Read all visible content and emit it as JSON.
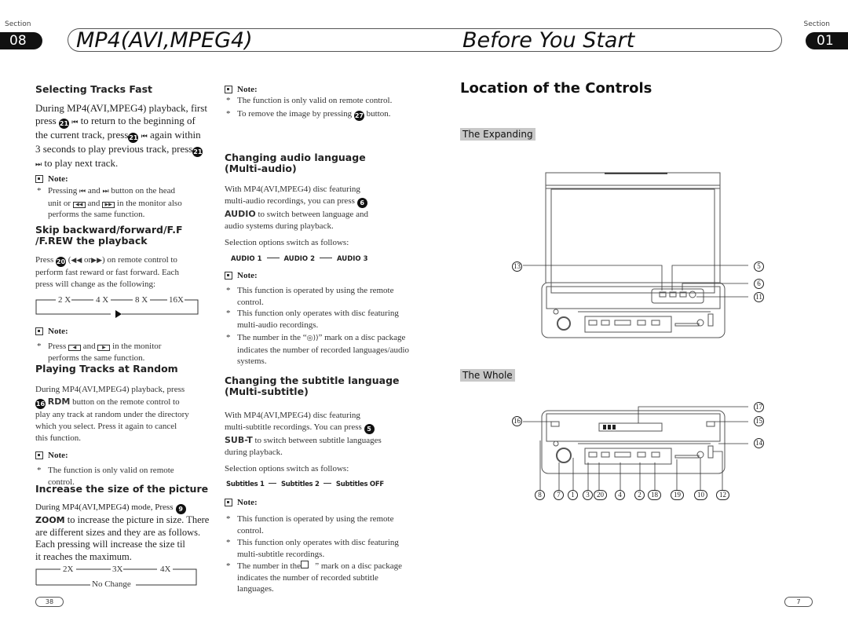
{
  "header": {
    "left": {
      "section_label": "Section",
      "section_number": "08",
      "title": "MP4(AVI,MPEG4)"
    },
    "right": {
      "section_label": "Section",
      "section_number": "01",
      "title": "Before You Start"
    }
  },
  "left_page": {
    "selecting_tracks": {
      "heading": "Selecting Tracks Fast",
      "body": [
        "During MP4(AVI,MPEG4) playback, first",
        "press",
        "to return to the beginning of",
        "the current track, press",
        "again within",
        "3 seconds to play previous track, press",
        "to play next track."
      ],
      "button_num": "21",
      "note_label": "Note:",
      "note": [
        "Pressing",
        "and",
        "button on the head",
        "unit or",
        "and",
        "in the monitor also",
        "performs the same function."
      ]
    },
    "skip": {
      "heading_line1": "Skip backward/forward/F.F",
      "heading_line2": "/F.REW the playback",
      "button_num": "20",
      "body": [
        "Press",
        "(",
        "or",
        ") on remote control to",
        "perform fast reward or fast forward. Each",
        "press will change as the following:"
      ],
      "flow": [
        "2 X",
        "4 X",
        "8 X",
        "16X"
      ],
      "note_label": "Note:",
      "note": [
        "Press",
        "and",
        "in the monitor",
        "performs the same function."
      ]
    },
    "random": {
      "heading": "Playing Tracks at Random",
      "button_num": "16",
      "keyword": "RDM",
      "body": [
        "During MP4(AVI,MPEG4) playback, press",
        "button on the remote control to",
        "play any track at random under the directory",
        "which you select. Press it again to cancel",
        "this function."
      ],
      "note_label": "Note:",
      "note": [
        "The function is only valid on remote",
        "control."
      ]
    },
    "zoom": {
      "heading": "Increase the size of the picture",
      "button_num": "9",
      "keyword": "ZOOM",
      "body": [
        "During MP4(AVI,MPEG4) mode, Press",
        "to increase the picture in size. There",
        "are different sizes and they are as follows.",
        "Each pressing will increase the size til",
        "it reaches the maximum."
      ],
      "flow": [
        "2X",
        "3X",
        "4X"
      ],
      "flow_return": "No Change"
    },
    "page_number": "38"
  },
  "middle": {
    "note1": {
      "label": "Note:",
      "items": [
        "The function is only valid on remote control.",
        "To remove the image by pressing",
        "button."
      ],
      "button_num": "27"
    },
    "audio": {
      "heading_line1": "Changing audio language",
      "heading_line2": "(Multi-audio)",
      "button_num": "6",
      "keyword": "AUDIO",
      "body": [
        "With MP4(AVI,MPEG4) disc featuring",
        "multi-audio recordings,  you can press",
        "to switch between language and",
        "audio systems during playback."
      ],
      "options_intro": "Selection options switch as follows:",
      "options": [
        "AUDIO 1",
        "AUDIO 2",
        "AUDIO 3"
      ],
      "note_label": "Note:",
      "note": [
        "This function is operated by using the remote control.",
        "This function only operates with disc featuring multi-audio recordings.",
        "The number in the “",
        "”  mark on a disc package indicates the number of recorded languages/audio systems."
      ]
    },
    "subtitle": {
      "heading_line1": "Changing the subtitle language",
      "heading_line2": "(Multi-subtitle)",
      "button_num": "5",
      "keyword": "SUB-T",
      "body": [
        "With MP4(AVI,MPEG4) disc featuring",
        "multi-subtitle recordings. You can press",
        "to switch between subtitle languages",
        "during playback."
      ],
      "options_intro": "Selection options switch as follows:",
      "options": [
        "Subtitles 1",
        "Subtitles 2",
        "Subtitles OFF"
      ],
      "note_label": "Note:",
      "note": [
        "This function is operated by using the remote control.",
        "This function only operates with disc featuring multi-subtitle recordings.",
        "The number in the",
        "”  mark on a disc package indicates the number of recorded subtitle languages."
      ]
    }
  },
  "right_page": {
    "heading": "Location of the Controls",
    "expanding_label": "The Expanding",
    "whole_label": "The Whole",
    "expanding_callouts": [
      "13",
      "5",
      "6",
      "11"
    ],
    "whole_callouts_top": [
      "16",
      "17",
      "15",
      "14"
    ],
    "whole_callouts_bottom": [
      "8",
      "7",
      "1",
      "3",
      "20",
      "4",
      "2",
      "18",
      "19",
      "10",
      "12"
    ],
    "page_number": "7"
  }
}
